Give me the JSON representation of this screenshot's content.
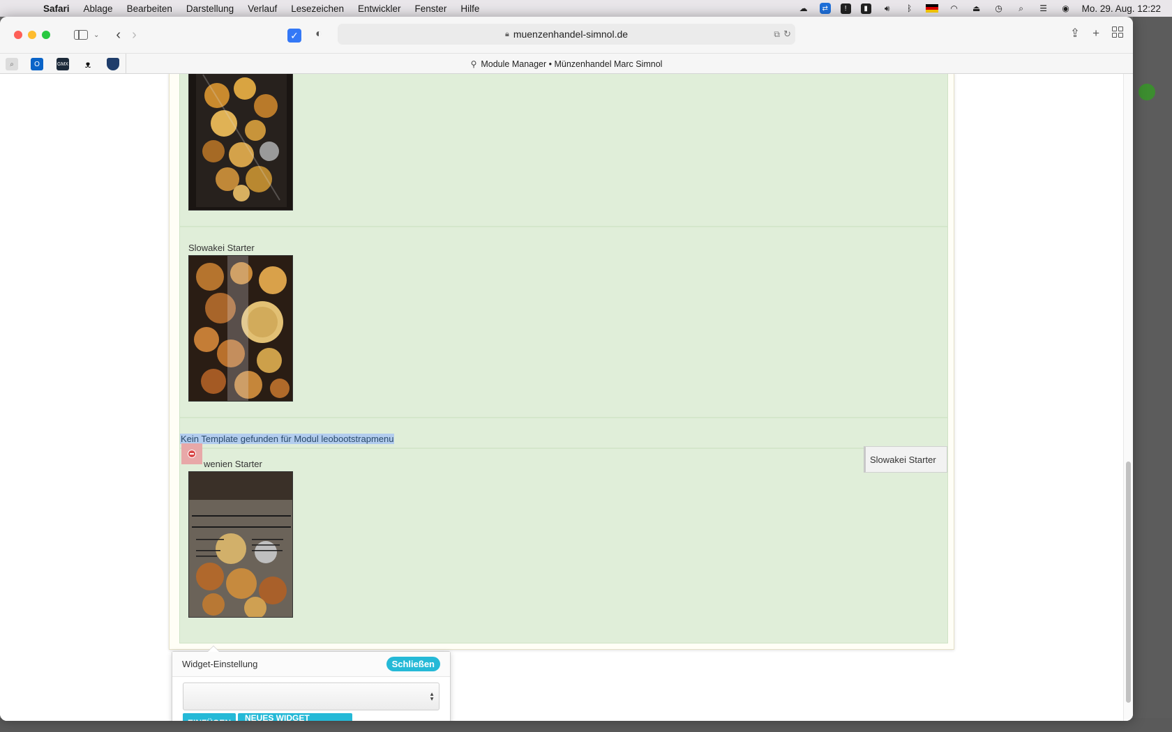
{
  "menubar": {
    "app": "Safari",
    "items": [
      "Ablage",
      "Bearbeiten",
      "Darstellung",
      "Verlauf",
      "Lesezeichen",
      "Entwickler",
      "Fenster",
      "Hilfe"
    ],
    "clock": "Mo. 29. Aug.  12:22"
  },
  "browser": {
    "url": "muenzenhandel-simnol.de",
    "tab_title": "Module Manager • Münzenhandel Marc Simnol"
  },
  "page": {
    "items": [
      {
        "label": "Slowakei Starter"
      },
      {
        "label": "Slowenien Starter",
        "visible_label": "wenien Starter"
      }
    ],
    "error_message": "Kein Template gefunden für Modul leobootstrapmenu",
    "drag_chip": "Slowakei Starter"
  },
  "widget_popover": {
    "title": "Widget-Einstellung",
    "close_label": "Schließen",
    "select_value": "",
    "insert_label": "EINFÜGEN",
    "create_label": "NEUES WIDGET ERSTELLEN"
  },
  "colors": {
    "accent": "#25b9d7",
    "drop_zone": "#e0eed9",
    "highlight": "#b3cdee",
    "remove": "#d94848"
  }
}
